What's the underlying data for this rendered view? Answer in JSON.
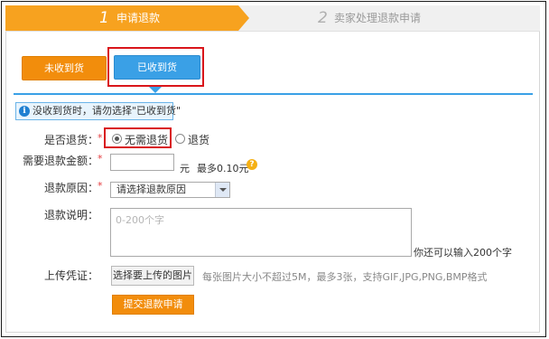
{
  "steps": [
    {
      "num": "1",
      "label": "申请退款",
      "active": true
    },
    {
      "num": "2",
      "label": "卖家处理退款申请",
      "active": false
    }
  ],
  "status_buttons": {
    "unreceived": "未收到货",
    "received": "已收到货",
    "selected": "received"
  },
  "tip": {
    "icon": "info-icon",
    "text": "没收到货时，请勿选择\"已收到货\""
  },
  "form": {
    "return_goods": {
      "label": "是否退货：",
      "required_mark": "*",
      "options": [
        "无需退货",
        "退货"
      ],
      "selected": "无需退货"
    },
    "refund_amount": {
      "label": "需要退款金额：",
      "required_mark": "*",
      "value": "",
      "unit": "元",
      "max_hint": "最多0.10元",
      "help_icon": "question-icon"
    },
    "refund_reason": {
      "label": "退款原因：",
      "required_mark": "*",
      "selected_text": "请选择退款原因"
    },
    "refund_note": {
      "label": "退款说明：",
      "placeholder": "0-200个字",
      "remaining": "你还可以输入200个字"
    },
    "upload": {
      "label": "上传凭证：",
      "button": "选择要上传的图片",
      "hint": "每张图片大小不超过5M，最多3张，支持GIF,JPG,PNG,BMP格式"
    },
    "submit": "提交退款申请"
  },
  "colors": {
    "accent_orange": "#f28d0c",
    "accent_blue": "#3aa0e6",
    "highlight_red": "#d9161b"
  }
}
